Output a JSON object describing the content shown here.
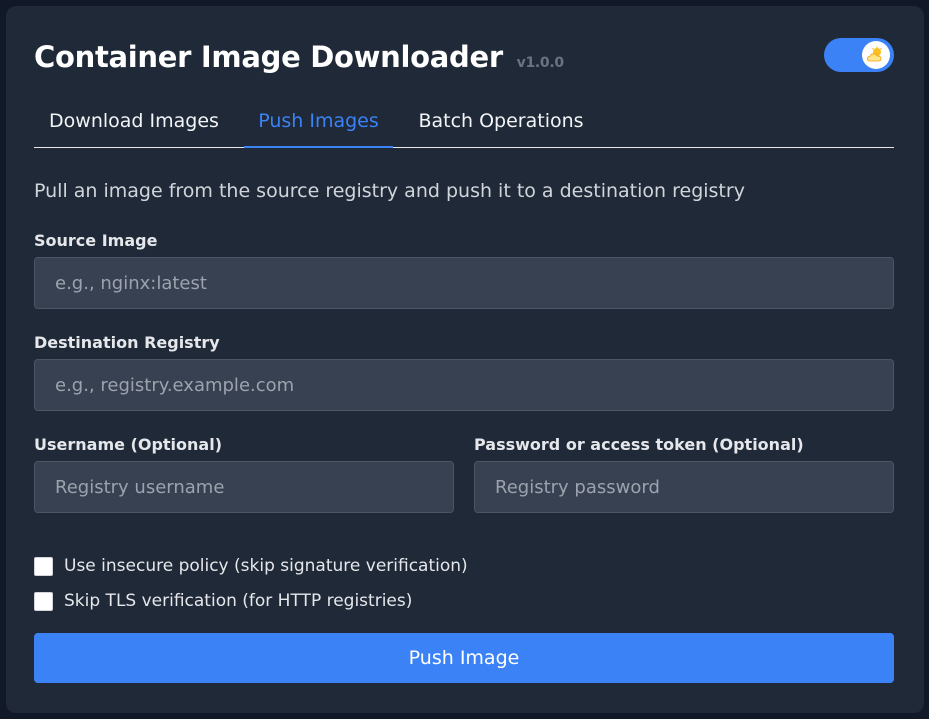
{
  "app": {
    "title": "Container Image Downloader",
    "version": "v1.0.0",
    "theme_toggle_on": true
  },
  "tabs": [
    {
      "label": "Download Images",
      "active": false
    },
    {
      "label": "Push Images",
      "active": true
    },
    {
      "label": "Batch Operations",
      "active": false
    }
  ],
  "push": {
    "description": "Pull an image from the source registry and push it to a destination registry",
    "source": {
      "label": "Source Image",
      "placeholder": "e.g., nginx:latest",
      "value": ""
    },
    "destination": {
      "label": "Destination Registry",
      "placeholder": "e.g., registry.example.com",
      "value": ""
    },
    "username": {
      "label": "Username (Optional)",
      "placeholder": "Registry username",
      "value": ""
    },
    "password": {
      "label": "Password or access token (Optional)",
      "placeholder": "Registry password",
      "value": ""
    },
    "insecure": {
      "label": "Use insecure policy (skip signature verification)",
      "checked": false
    },
    "skip_tls": {
      "label": "Skip TLS verification (for HTTP registries)",
      "checked": false
    },
    "button_label": "Push Image"
  },
  "colors": {
    "accent": "#3b82f6",
    "card_bg": "#1f2937",
    "page_bg": "#111827",
    "input_bg": "#374151"
  },
  "icons": {
    "theme_toggle": "cloud-sun-icon"
  }
}
